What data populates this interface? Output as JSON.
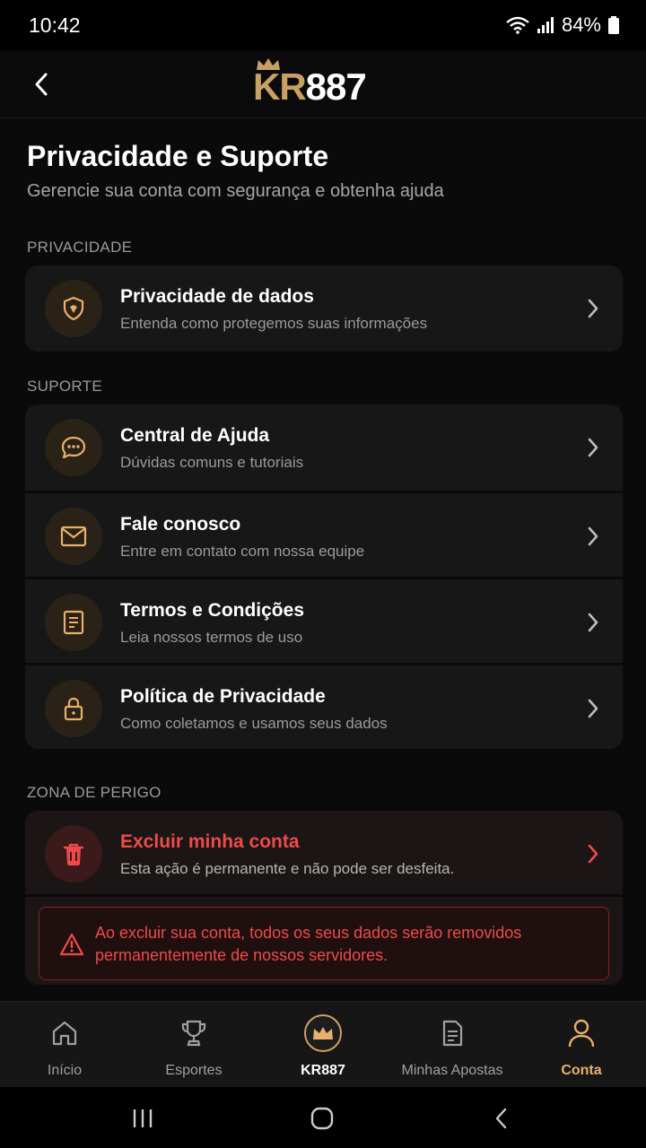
{
  "status_bar": {
    "time": "10:42",
    "battery": "84%"
  },
  "header": {
    "logo_kr": "KR",
    "logo_num": "887"
  },
  "page": {
    "title": "Privacidade e Suporte",
    "subtitle": "Gerencie sua conta com segurança e obtenha ajuda"
  },
  "sections": {
    "privacy_label": "PRIVACIDADE",
    "support_label": "SUPORTE",
    "danger_label": "ZONA DE PERIGO"
  },
  "privacy_items": [
    {
      "title": "Privacidade de dados",
      "subtitle": "Entenda como protegemos suas informações",
      "icon": "shield-icon"
    }
  ],
  "support_items": [
    {
      "title": "Central de Ajuda",
      "subtitle": "Dúvidas comuns e tutoriais",
      "icon": "chat-bubble-icon"
    },
    {
      "title": "Fale conosco",
      "subtitle": "Entre em contato com nossa equipe",
      "icon": "mail-icon"
    },
    {
      "title": "Termos e Condições",
      "subtitle": "Leia nossos termos de uso",
      "icon": "document-icon"
    },
    {
      "title": "Política de Privacidade",
      "subtitle": "Como coletamos e usamos seus dados",
      "icon": "lock-icon"
    }
  ],
  "danger": {
    "title": "Excluir minha conta",
    "subtitle": "Esta ação é permanente e não pode ser desfeita.",
    "icon": "trash-icon",
    "warning": "Ao excluir sua conta, todos os seus dados serão removidos permanentemente de nossos servidores."
  },
  "bottom_nav": [
    {
      "label": "Início",
      "icon": "home-icon"
    },
    {
      "label": "Esportes",
      "icon": "trophy-icon"
    },
    {
      "label": "KR887",
      "icon": "crown-icon"
    },
    {
      "label": "Minhas Apostas",
      "icon": "bets-document-icon"
    },
    {
      "label": "Conta",
      "icon": "user-icon",
      "active": true
    }
  ],
  "colors": {
    "accent_gold": "#e8b06a",
    "danger_red": "#ef4a4a",
    "background": "#0a0a0a",
    "card": "#171717"
  }
}
